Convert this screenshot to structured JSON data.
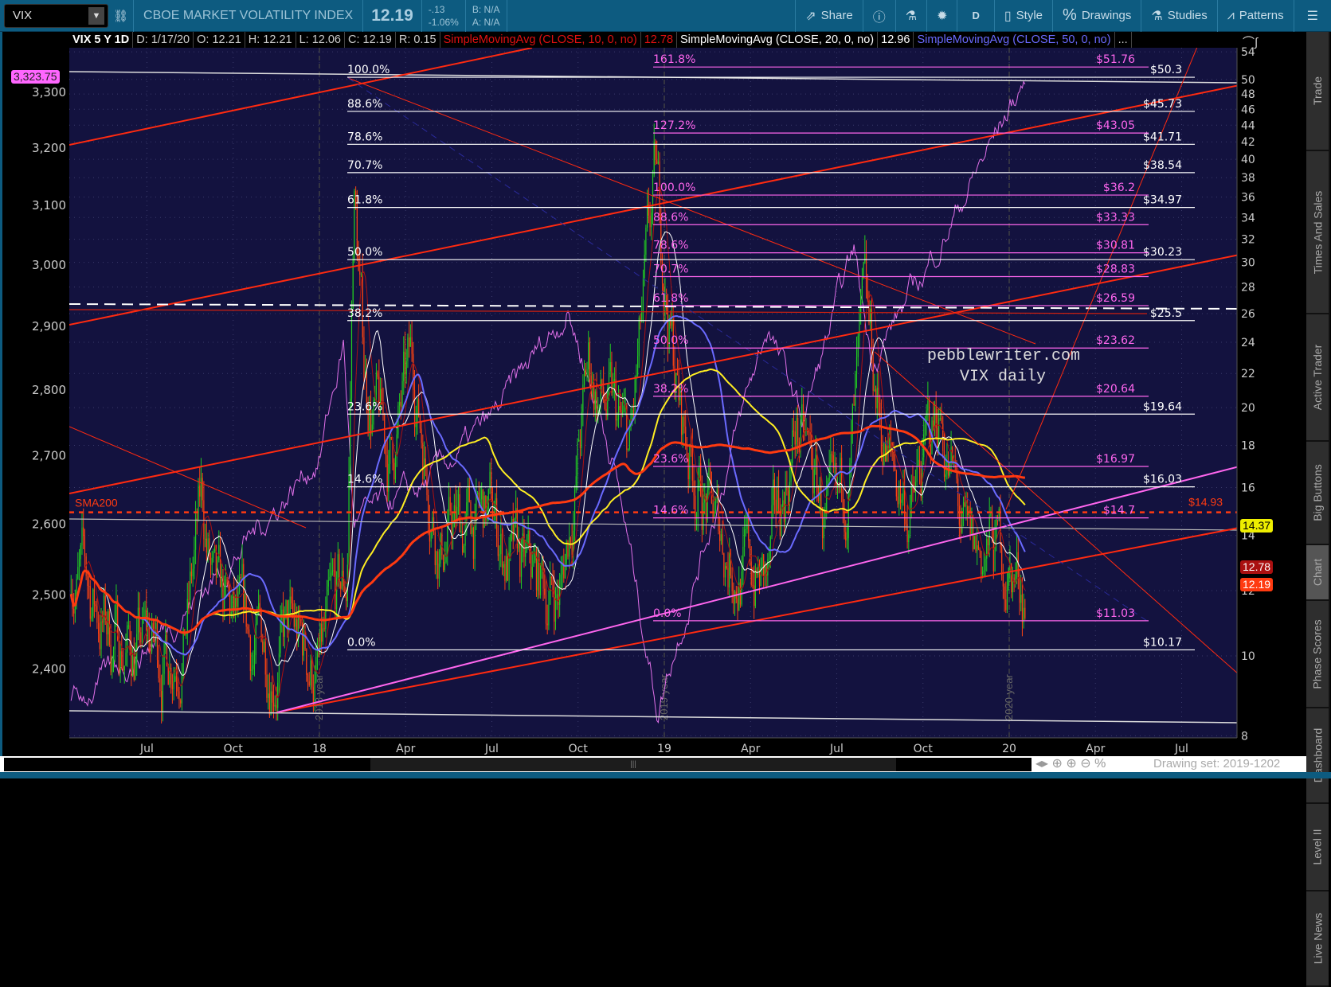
{
  "toolbar": {
    "symbol": "VIX",
    "description": "CBOE MARKET VOLATILITY INDEX",
    "last": "12.19",
    "change": "-.13",
    "change_pct": "-1.06%",
    "bid": "B: N/A",
    "ask": "A: N/A",
    "buttons": {
      "share": "Share",
      "period": "D",
      "style": "Style",
      "drawings": "Drawings",
      "studies": "Studies",
      "patterns": "Patterns"
    }
  },
  "infobar": {
    "title": "VIX 5 Y 1D",
    "date": "D: 1/17/20",
    "open": "O: 12.21",
    "high": "H: 12.21",
    "low": "L: 12.06",
    "close": "C: 12.19",
    "range": "R: 0.15",
    "sma10": "SimpleMovingAvg (CLOSE, 10, 0, no)",
    "sma10_val": "12.78",
    "sma20": "SimpleMovingAvg (CLOSE, 20, 0, no)",
    "sma20_val": "12.96",
    "sma50": "SimpleMovingAvg (CLOSE, 50, 0, no)",
    "more": "..."
  },
  "badges": {
    "spx": "3,323.75",
    "line": "14.37",
    "sma10": "12.78",
    "last": "12.19"
  },
  "sma200": {
    "label": "SMA200",
    "value": "$14.93",
    "level": 14.93
  },
  "watermark": [
    "pebblewriter.com",
    "VIX daily"
  ],
  "colors": {
    "toolbar": "#0d5b80",
    "plot_bg": "#13123f",
    "up": "#22cc22",
    "down": "#ff4411",
    "spx": "#e070e8",
    "fib_white": "#ffffff",
    "fib_pink": "#ff66ee"
  },
  "chart_data": {
    "type": "candlestick",
    "right_axis": {
      "label": "VIX",
      "scale": "log",
      "ticks": [
        54,
        50,
        48,
        46,
        44,
        42,
        40,
        38,
        36,
        34,
        32,
        30,
        28,
        26,
        24,
        22,
        20,
        18,
        16,
        14,
        12,
        10,
        8
      ]
    },
    "left_axis": {
      "label": "SPX",
      "scale": "log",
      "ticks": [
        "3,300",
        "3,200",
        "3,100",
        "3,000",
        "2,900",
        "2,800",
        "2,700",
        "2,600",
        "2,500",
        "2,400"
      ],
      "tick_values": [
        3300,
        3200,
        3100,
        3000,
        2900,
        2800,
        2700,
        2600,
        2500,
        2400
      ]
    },
    "x_ticks": [
      {
        "label": "Jul",
        "t": 2017.5
      },
      {
        "label": "Oct",
        "t": 2017.75
      },
      {
        "label": "18",
        "t": 2018
      },
      {
        "label": "Apr",
        "t": 2018.25
      },
      {
        "label": "Jul",
        "t": 2018.5
      },
      {
        "label": "Oct",
        "t": 2018.75
      },
      {
        "label": "19",
        "t": 2019
      },
      {
        "label": "Apr",
        "t": 2019.25
      },
      {
        "label": "Jul",
        "t": 2019.5
      },
      {
        "label": "Oct",
        "t": 2019.75
      },
      {
        "label": "20",
        "t": 2020
      },
      {
        "label": "Apr",
        "t": 2020.25
      },
      {
        "label": "Jul",
        "t": 2020.5
      }
    ],
    "year_markers": [
      {
        "label": "2018 year",
        "t": 2018
      },
      {
        "label": "2019 year",
        "t": 2019
      },
      {
        "label": "2020 year",
        "t": 2020
      }
    ],
    "fib_white": [
      {
        "pct": "100.0%",
        "price": "$50.3",
        "v": 50.3
      },
      {
        "pct": "88.6%",
        "price": "$45.73",
        "v": 45.73
      },
      {
        "pct": "78.6%",
        "price": "$41.71",
        "v": 41.71
      },
      {
        "pct": "70.7%",
        "price": "$38.54",
        "v": 38.54
      },
      {
        "pct": "61.8%",
        "price": "$34.97",
        "v": 34.97
      },
      {
        "pct": "50.0%",
        "price": "$30.23",
        "v": 30.23
      },
      {
        "pct": "38.2%",
        "price": "$25.5",
        "v": 25.5
      },
      {
        "pct": "23.6%",
        "price": "$19.64",
        "v": 19.64
      },
      {
        "pct": "14.6%",
        "price": "$16.03",
        "v": 16.03
      },
      {
        "pct": "0.0%",
        "price": "$10.17",
        "v": 10.17
      }
    ],
    "fib_pink": [
      {
        "pct": "161.8%",
        "price": "$51.76",
        "v": 51.76
      },
      {
        "pct": "127.2%",
        "price": "$43.05",
        "v": 43.05
      },
      {
        "pct": "100.0%",
        "price": "$36.2",
        "v": 36.2
      },
      {
        "pct": "88.6%",
        "price": "$33.33",
        "v": 33.33
      },
      {
        "pct": "78.6%",
        "price": "$30.81",
        "v": 30.81
      },
      {
        "pct": "70.7%",
        "price": "$28.83",
        "v": 28.83
      },
      {
        "pct": "61.8%",
        "price": "$26.59",
        "v": 26.59
      },
      {
        "pct": "50.0%",
        "price": "$23.62",
        "v": 23.62
      },
      {
        "pct": "38.2%",
        "price": "$20.64",
        "v": 20.64
      },
      {
        "pct": "23.6%",
        "price": "$16.97",
        "v": 16.97
      },
      {
        "pct": "14.6%",
        "price": "$14.7",
        "v": 14.7
      },
      {
        "pct": "0.0%",
        "price": "$11.03",
        "v": 11.03
      }
    ],
    "vix_anchors": [
      [
        2017.28,
        13
      ],
      [
        2017.4,
        10.5
      ],
      [
        2017.55,
        10
      ],
      [
        2017.62,
        11.5
      ],
      [
        2017.66,
        15
      ],
      [
        2017.7,
        11
      ],
      [
        2017.8,
        10
      ],
      [
        2017.9,
        10.5
      ],
      [
        2018.0,
        9.5
      ],
      [
        2018.08,
        12
      ],
      [
        2018.1,
        37
      ],
      [
        2018.13,
        22
      ],
      [
        2018.2,
        17
      ],
      [
        2018.27,
        22
      ],
      [
        2018.35,
        14
      ],
      [
        2018.5,
        14.5
      ],
      [
        2018.55,
        13
      ],
      [
        2018.6,
        12
      ],
      [
        2018.7,
        12
      ],
      [
        2018.78,
        22
      ],
      [
        2018.85,
        19
      ],
      [
        2018.9,
        17
      ],
      [
        2018.975,
        36
      ],
      [
        2019.05,
        19
      ],
      [
        2019.15,
        14
      ],
      [
        2019.3,
        12
      ],
      [
        2019.38,
        19
      ],
      [
        2019.5,
        13
      ],
      [
        2019.58,
        24
      ],
      [
        2019.65,
        17
      ],
      [
        2019.72,
        15
      ],
      [
        2019.8,
        20
      ],
      [
        2019.88,
        12.5
      ],
      [
        2019.95,
        13.5
      ],
      [
        2020.046,
        12.19
      ]
    ],
    "spx_anchors": [
      [
        2017.28,
        2350
      ],
      [
        2017.5,
        2430
      ],
      [
        2017.75,
        2550
      ],
      [
        2018.0,
        2700
      ],
      [
        2018.07,
        2870
      ],
      [
        2018.1,
        2600
      ],
      [
        2018.3,
        2650
      ],
      [
        2018.5,
        2750
      ],
      [
        2018.72,
        2930
      ],
      [
        2018.85,
        2700
      ],
      [
        2018.98,
        2350
      ],
      [
        2019.3,
        2900
      ],
      [
        2019.4,
        2750
      ],
      [
        2019.55,
        3020
      ],
      [
        2019.6,
        2850
      ],
      [
        2019.75,
        2980
      ],
      [
        2019.9,
        3150
      ],
      [
        2020.046,
        3323.75
      ]
    ],
    "studies": [
      {
        "name": "SMA10",
        "color": "#aa1111"
      },
      {
        "name": "SMA20",
        "color": "#ffffff"
      },
      {
        "name": "SMA50",
        "color": "#6a6aff"
      },
      {
        "name": "SMA100",
        "color": "#ffee22"
      },
      {
        "name": "SMA200",
        "color": "#ff3a10"
      }
    ]
  },
  "sidetabs": [
    "Trade",
    "Times And Sales",
    "Active Trader",
    "Big Buttons",
    "Chart",
    "Phase Scores",
    "Dashboard",
    "Level II",
    "Live News"
  ],
  "footer": {
    "drawing_set": "Drawing set: 2019-1202"
  }
}
